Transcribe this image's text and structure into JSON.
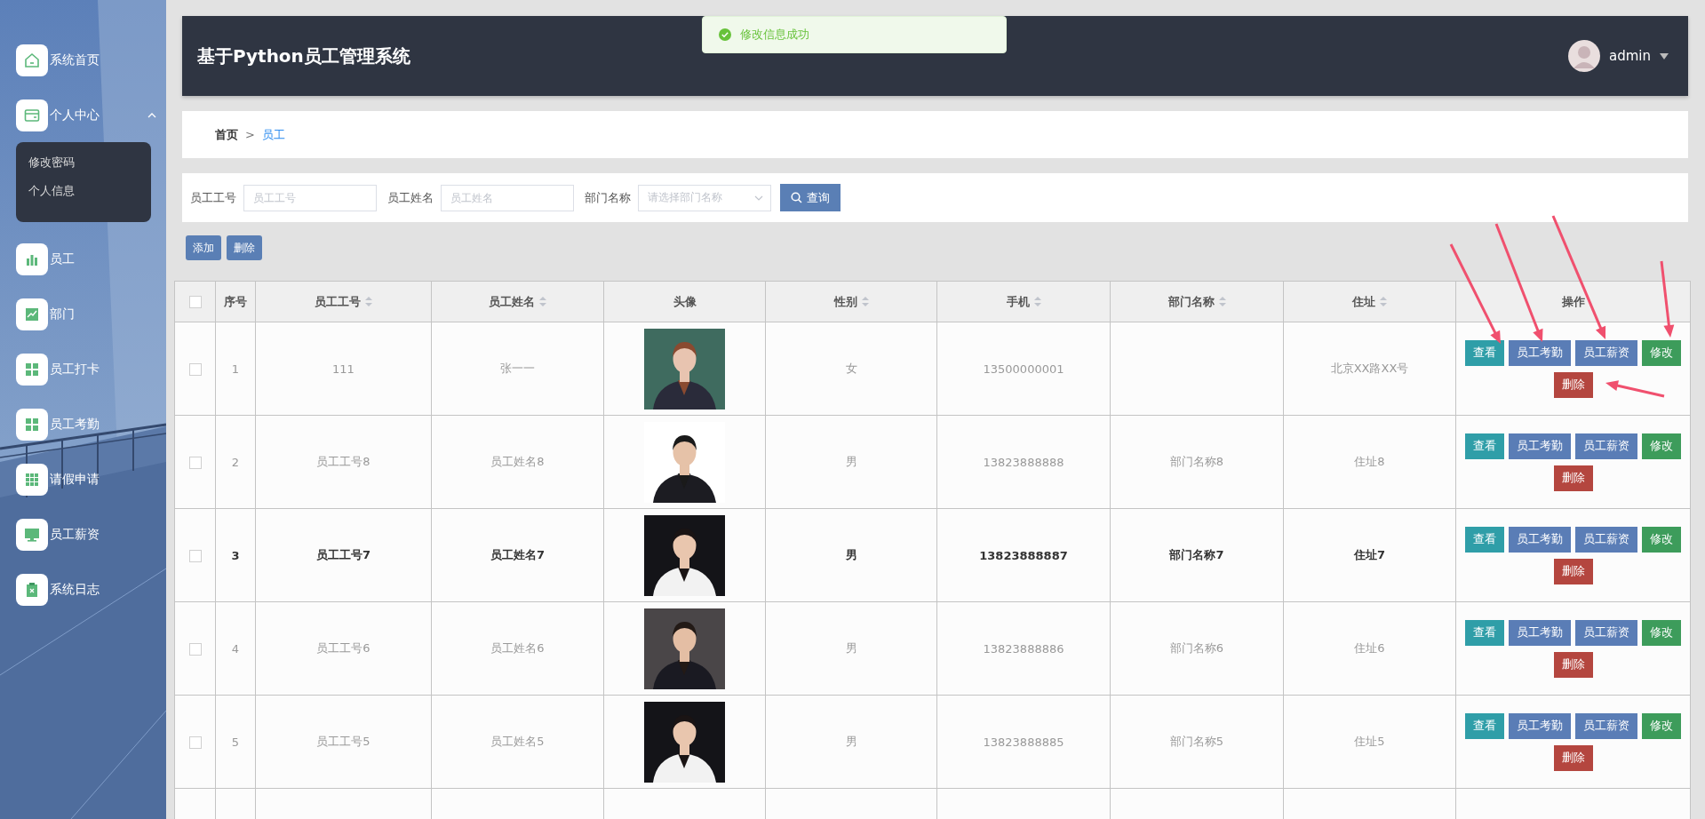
{
  "sidebar": {
    "items": [
      {
        "label": "系统首页"
      },
      {
        "label": "个人中心",
        "expanded": true,
        "children": [
          {
            "label": "修改密码"
          },
          {
            "label": "个人信息"
          }
        ]
      },
      {
        "label": "员工"
      },
      {
        "label": "部门"
      },
      {
        "label": "员工打卡"
      },
      {
        "label": "员工考勤"
      },
      {
        "label": "请假申请"
      },
      {
        "label": "员工薪资"
      },
      {
        "label": "系统日志"
      }
    ]
  },
  "header": {
    "title": "基于Python员工管理系统",
    "user": "admin"
  },
  "toast": {
    "message": "修改信息成功"
  },
  "breadcrumb": {
    "separator": ">",
    "items": [
      {
        "label": "首页",
        "current": false
      },
      {
        "label": "员工",
        "current": true
      }
    ]
  },
  "filters": {
    "fields": [
      {
        "label": "员工工号",
        "placeholder": "员工工号",
        "kind": "text"
      },
      {
        "label": "员工姓名",
        "placeholder": "员工姓名",
        "kind": "text"
      },
      {
        "label": "部门名称",
        "placeholder": "请选择部门名称",
        "kind": "select"
      }
    ],
    "search_button": "查询"
  },
  "toolbar": [
    "添加",
    "删除"
  ],
  "table": {
    "all_checked": false,
    "columns": [
      {
        "label": "序号",
        "sortable": false
      },
      {
        "label": "员工工号",
        "sortable": true
      },
      {
        "label": "员工姓名",
        "sortable": true
      },
      {
        "label": "头像",
        "sortable": false
      },
      {
        "label": "性别",
        "sortable": true
      },
      {
        "label": "手机",
        "sortable": true
      },
      {
        "label": "部门名称",
        "sortable": true
      },
      {
        "label": "住址",
        "sortable": true
      },
      {
        "label": "操作",
        "sortable": false
      }
    ],
    "rows": [
      {
        "checked": false,
        "hovered": false,
        "index": "1",
        "id": "111",
        "name": "张一一",
        "gender": "女",
        "phone": "13500000001",
        "address": "北京XX路XX号",
        "actions": [
          {
            "label": "查看",
            "kind": "view"
          },
          {
            "label": "员工考勤",
            "kind": "attendance"
          },
          {
            "label": "员工薪资",
            "kind": "salary"
          },
          {
            "label": "修改",
            "kind": "edit"
          },
          {
            "label": "删除",
            "kind": "delete"
          }
        ]
      },
      {
        "checked": false,
        "hovered": false,
        "index": "2",
        "id": "员工工号8",
        "name": "员工姓名8",
        "gender": "男",
        "phone": "13823888888",
        "department": "部门名称8",
        "address": "住址8",
        "actions": [
          {
            "label": "查看",
            "kind": "view"
          },
          {
            "label": "员工考勤",
            "kind": "attendance"
          },
          {
            "label": "员工薪资",
            "kind": "salary"
          },
          {
            "label": "修改",
            "kind": "edit"
          },
          {
            "label": "删除",
            "kind": "delete"
          }
        ]
      },
      {
        "checked": false,
        "hovered": true,
        "index": "3",
        "id": "员工工号7",
        "name": "员工姓名7",
        "gender": "男",
        "phone": "13823888887",
        "department": "部门名称7",
        "address": "住址7",
        "actions": [
          {
            "label": "查看",
            "kind": "view"
          },
          {
            "label": "员工考勤",
            "kind": "attendance"
          },
          {
            "label": "员工薪资",
            "kind": "salary"
          },
          {
            "label": "修改",
            "kind": "edit"
          },
          {
            "label": "删除",
            "kind": "delete"
          }
        ]
      },
      {
        "checked": false,
        "hovered": false,
        "index": "4",
        "id": "员工工号6",
        "name": "员工姓名6",
        "gender": "男",
        "phone": "13823888886",
        "department": "部门名称6",
        "address": "住址6",
        "actions": [
          {
            "label": "查看",
            "kind": "view"
          },
          {
            "label": "员工考勤",
            "kind": "attendance"
          },
          {
            "label": "员工薪资",
            "kind": "salary"
          },
          {
            "label": "修改",
            "kind": "edit"
          },
          {
            "label": "删除",
            "kind": "delete"
          }
        ]
      },
      {
        "checked": false,
        "hovered": false,
        "index": "5",
        "id": "员工工号5",
        "name": "员工姓名5",
        "gender": "男",
        "phone": "13823888885",
        "department": "部门名称5",
        "address": "住址5",
        "actions": [
          {
            "label": "查看",
            "kind": "view"
          },
          {
            "label": "员工考勤",
            "kind": "attendance"
          },
          {
            "label": "员工薪资",
            "kind": "salary"
          },
          {
            "label": "修改",
            "kind": "edit"
          },
          {
            "label": "删除",
            "kind": "delete"
          }
        ]
      }
    ]
  }
}
